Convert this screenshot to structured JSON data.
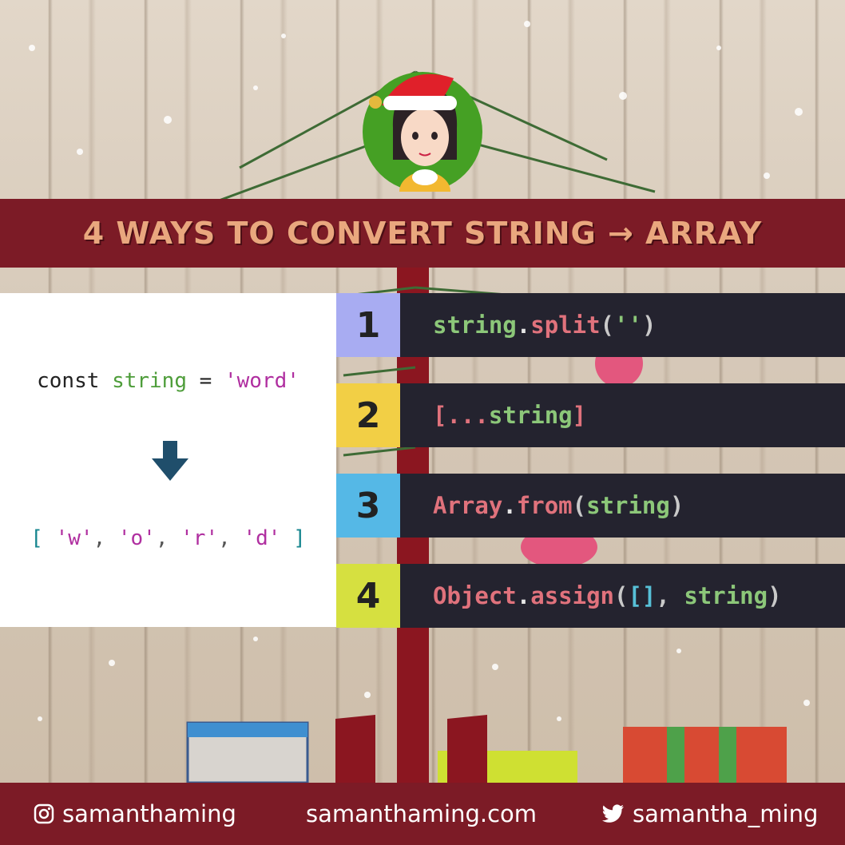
{
  "title": "4 Ways to Convert String → Array",
  "example": {
    "keyword": "const",
    "variable": "string",
    "operator": "=",
    "value": "'word'",
    "result_open": "[",
    "result_items": [
      "'w'",
      "'o'",
      "'r'",
      "'d'"
    ],
    "result_close": "]"
  },
  "methods": [
    {
      "number": "1",
      "color": "#a8acf2"
    },
    {
      "number": "2",
      "color": "#f2cf45"
    },
    {
      "number": "3",
      "color": "#55b8e6"
    },
    {
      "number": "4",
      "color": "#d6e040"
    }
  ],
  "code": {
    "m1": {
      "obj": "string",
      "dot": ".",
      "fn": "split",
      "open": "(",
      "arg": "''",
      "close": ")"
    },
    "m2": {
      "open": "[",
      "spread": "...",
      "arg": "string",
      "close": "]"
    },
    "m3": {
      "obj": "Array",
      "dot": ".",
      "fn": "from",
      "open": "(",
      "arg": "string",
      "close": ")"
    },
    "m4": {
      "obj": "Object",
      "dot": ".",
      "fn": "assign",
      "open": "(",
      "arr": "[]",
      "comma": ", ",
      "arg": "string",
      "close": ")"
    }
  },
  "footer": {
    "instagram": "samanthaming",
    "website": "samanthaming.com",
    "twitter": "samantha_ming"
  },
  "icons": {
    "instagram": "instagram-icon",
    "twitter": "twitter-icon",
    "arrow": "arrow-down-icon",
    "avatar": "santa-avatar"
  }
}
